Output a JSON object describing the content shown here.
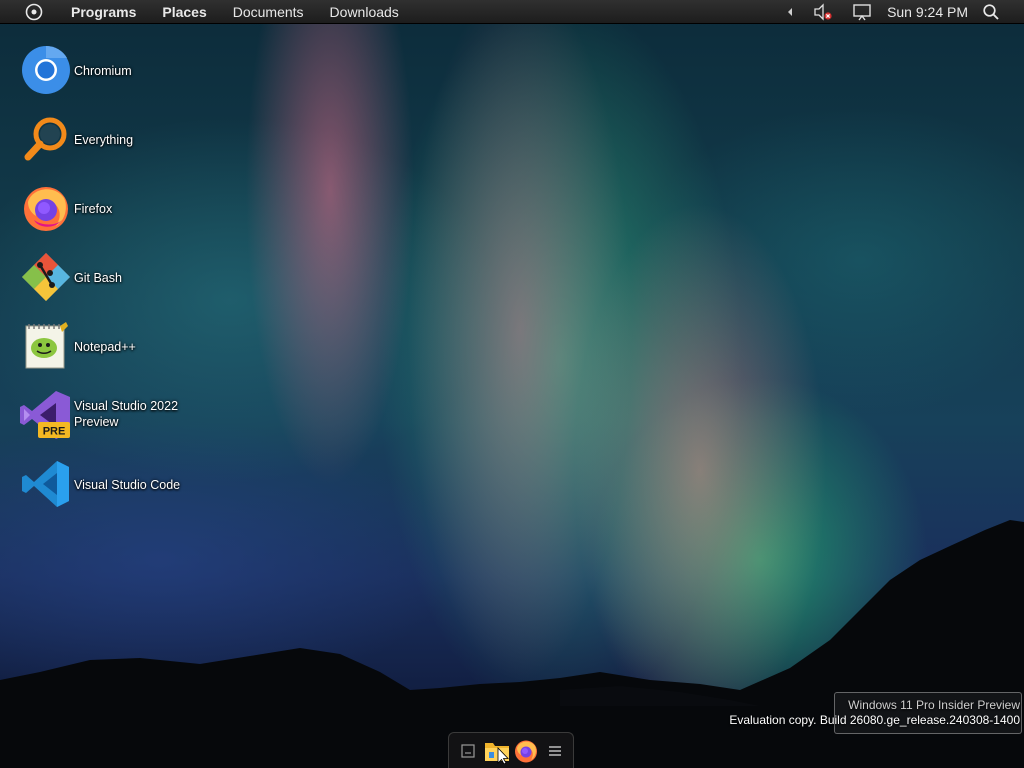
{
  "top_panel": {
    "menus": [
      "Programs",
      "Places",
      "Documents",
      "Downloads"
    ],
    "clock": "Sun 9:24 PM"
  },
  "desktop": {
    "icons": [
      {
        "label": "Chromium",
        "icon": "chromium-icon"
      },
      {
        "label": "Everything",
        "icon": "everything-search-icon"
      },
      {
        "label": "Firefox",
        "icon": "firefox-icon"
      },
      {
        "label": "Git Bash",
        "icon": "git-bash-icon"
      },
      {
        "label": "Notepad++",
        "icon": "notepad-plus-plus-icon"
      },
      {
        "label": "Visual Studio 2022 Preview",
        "icon": "visual-studio-preview-icon",
        "badge": "PRE"
      },
      {
        "label": "Visual Studio Code",
        "icon": "vscode-icon"
      }
    ]
  },
  "watermark": {
    "line1": "Windows 11 Pro Insider Preview",
    "line2": "Evaluation copy. Build 26080.ge_release.240308-1400"
  },
  "dock": {
    "items": [
      "show-desktop-icon",
      "file-manager-icon",
      "firefox-icon",
      "menu-icon"
    ]
  },
  "colors": {
    "panel": "#1d1d1d",
    "vs_purple": "#6c3bb0",
    "vscode_blue": "#1f8ad2",
    "pre_badge": "#f3b823"
  }
}
